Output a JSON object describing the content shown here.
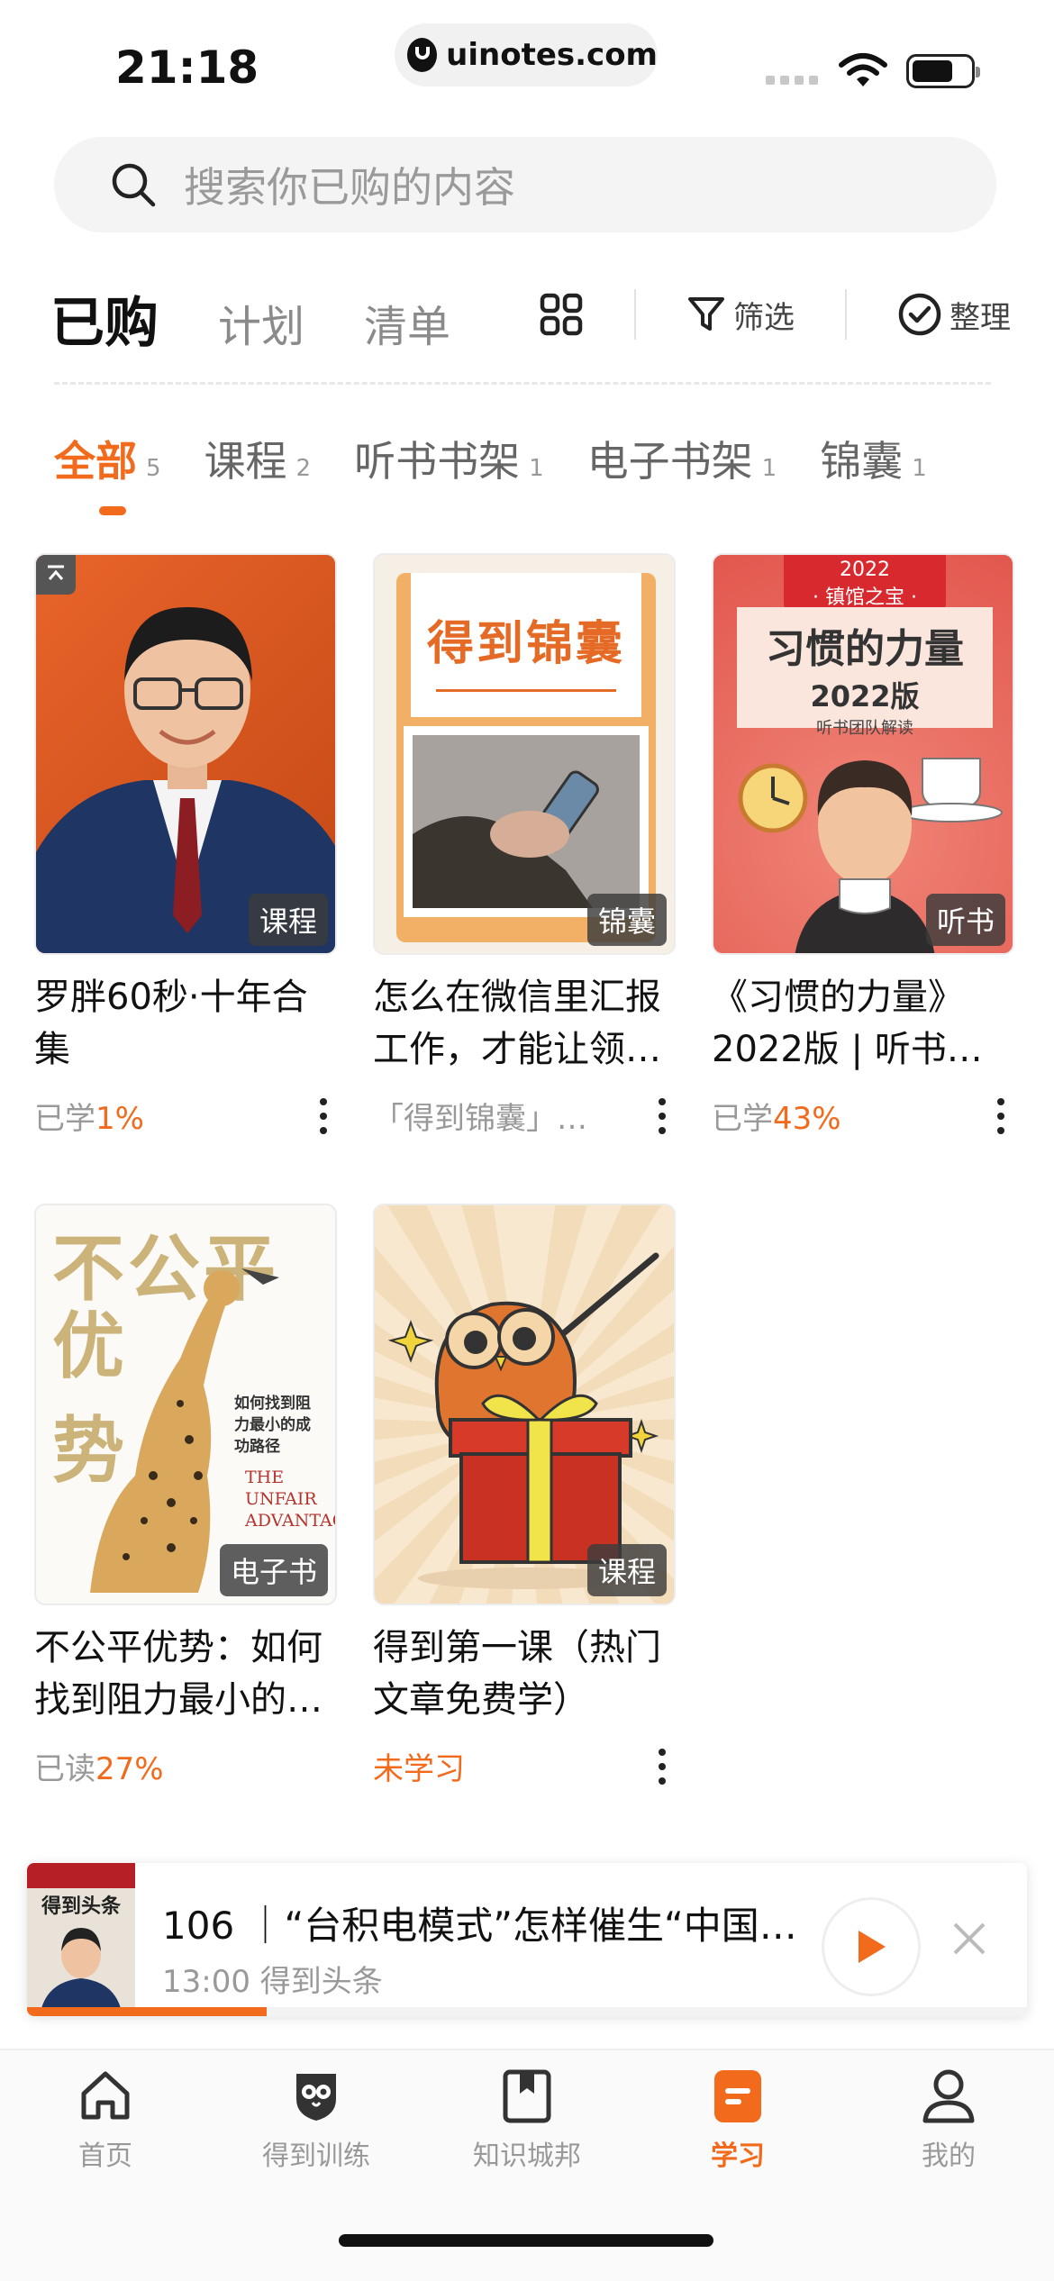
{
  "status_bar": {
    "time": "21:18",
    "url": "uinotes.com"
  },
  "search": {
    "placeholder": "搜索你已购的内容"
  },
  "main_tabs": [
    {
      "label": "已购",
      "active": true
    },
    {
      "label": "计划",
      "active": false
    },
    {
      "label": "清单",
      "active": false
    }
  ],
  "toolbar": {
    "filter_label": "筛选",
    "organize_label": "整理"
  },
  "sub_tabs": [
    {
      "label": "全部",
      "count": "5",
      "active": true
    },
    {
      "label": "课程",
      "count": "2"
    },
    {
      "label": "听书书架",
      "count": "1"
    },
    {
      "label": "电子书架",
      "count": "1"
    },
    {
      "label": "锦囊",
      "count": "1"
    }
  ],
  "cards": [
    {
      "title": "罗胖60秒·十年合集",
      "badge": "课程",
      "meta_prefix": "已学",
      "meta_value": "1%",
      "has_more": true
    },
    {
      "title": "怎么在微信里汇报工作，才能让领…",
      "badge": "锦囊",
      "meta_prefix": "「得到锦囊」…",
      "meta_value": "",
      "has_more": true,
      "cover_title": "得到锦囊"
    },
    {
      "title": "《习惯的力量》2022版 | 听书…",
      "badge": "听书",
      "meta_prefix": "已学",
      "meta_value": "43%",
      "has_more": true,
      "cover_top": "2022",
      "cover_sub": "· 镇馆之宝 ·",
      "cover_title": "习惯的力量",
      "cover_edition": "2022版",
      "cover_team": "听书团队解读"
    },
    {
      "title": "不公平优势：如何找到阻力最小的…",
      "badge": "电子书",
      "meta_prefix": "已读",
      "meta_value": "27%",
      "has_more": false,
      "cover_title_1": "不公平",
      "cover_title_2": "优势",
      "cover_subtitle": "如何找到阻力最小的成功路径",
      "cover_en": "THE UNFAIR ADVANTAGE"
    },
    {
      "title": "得到第一课（热门文章免费学）",
      "badge": "课程",
      "meta_prefix": "",
      "meta_value": "未学习",
      "has_more": true
    }
  ],
  "player": {
    "title": "106 ｜“台积电模式”怎样催生“中国…",
    "subtitle": "13:00 得到头条",
    "thumb_label": "得到头条",
    "progress": 0.24
  },
  "bottom_nav": [
    {
      "label": "首页",
      "icon": "home-icon",
      "active": false
    },
    {
      "label": "得到训练",
      "icon": "owl-shield-icon",
      "active": false
    },
    {
      "label": "知识城邦",
      "icon": "bookmark-book-icon",
      "active": false
    },
    {
      "label": "学习",
      "icon": "study-icon",
      "active": true
    },
    {
      "label": "我的",
      "icon": "profile-icon",
      "active": false
    }
  ],
  "colors": {
    "accent": "#f26a1b"
  }
}
